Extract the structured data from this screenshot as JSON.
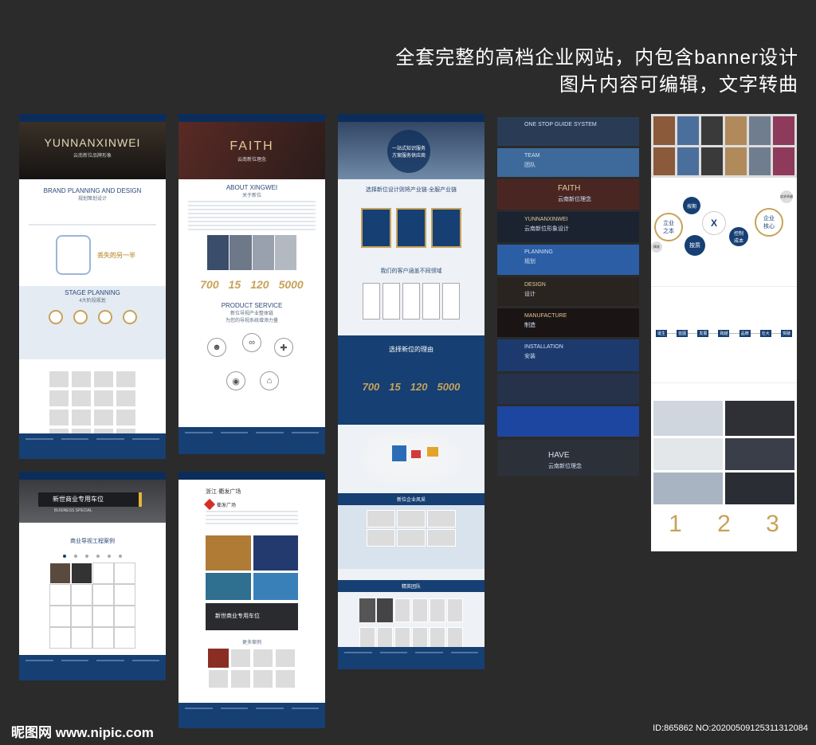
{
  "headline": {
    "line1": "全套完整的高档企业网站，内包含banner设计",
    "line2": "图片内容可编辑，文字转曲"
  },
  "panel1": {
    "hero_title": "YUNNANXINWEI",
    "hero_sub": "云南新位品牌形象",
    "sec1_en": "BRAND PLANNING AND DESIGN",
    "sec1_cn": "规划策划设计",
    "highlight": "丢失的另一半",
    "sec2_en": "STAGE PLANNING",
    "sec2_cn": "4大阶段规划"
  },
  "panel2": {
    "hero_title": "FAITH",
    "hero_sub": "云南新位理念",
    "about_en": "ABOUT XINGWEI",
    "about_cn": "关于新位",
    "numbers": [
      "700",
      "15",
      "120",
      "5000"
    ],
    "service_en": "PRODUCT SERVICE",
    "service_cn1": "新位导视产业整体链",
    "service_cn2": "为您的导视系统增添力量"
  },
  "panel3": {
    "hero_sub": "一站式知识服务 方案服务供应商",
    "intro": "选择新位设计则将产业链·全服产业链",
    "mid_title": "我们的客户涵盖不同领域",
    "reason_title": "选择新位的理由",
    "numbers": [
      "700",
      "15",
      "120",
      "5000"
    ],
    "style_title": "新位企业风采",
    "team_title": "精英团队"
  },
  "panel4": {
    "sign_text": "新世商业专用车位",
    "sign_en": "BUSINESS SPECIAL",
    "case_title": "商业导视工程案例"
  },
  "panel5": {
    "case_title": "浙江·衢发广场",
    "case_brand": "衢发广场",
    "sign_text": "新世商业专用车位",
    "more_title": "更多案例"
  },
  "banners": [
    {
      "title": "ONE STOP GUIDE SYSTEM",
      "sub": "",
      "bg": "#2a3c55"
    },
    {
      "title": "TEAM",
      "sub": "团队",
      "bg": "#3d6a9a"
    },
    {
      "title": "FAITH",
      "sub": "云南新位理念",
      "bg": "#4a2622"
    },
    {
      "title": "YUNNANXINWEI",
      "sub": "云南新位形象设计",
      "bg": "#1c2330"
    },
    {
      "title": "PLANNING",
      "sub": "规划",
      "bg": "#2c5ea6"
    },
    {
      "title": "DESIGN",
      "sub": "设计",
      "bg": "#2a2420"
    },
    {
      "title": "MANUFACTURE",
      "sub": "制造",
      "bg": "#1b1414"
    },
    {
      "title": "INSTALLATION",
      "sub": "安装",
      "bg": "#1d3a6e"
    },
    {
      "title": "",
      "sub": "",
      "bg": "#25324a"
    },
    {
      "title": "",
      "sub": "",
      "bg": "#1d46a0"
    },
    {
      "title": "HAVE",
      "sub": "云南新位理念",
      "bg": "#2c3038"
    }
  ],
  "panel6": {
    "core_left": "立业\n之本",
    "core_right": "企业\n核心",
    "center_a": "按期",
    "center_b": "按质",
    "center_c": "控制\n成本",
    "small_1": "追求卓越",
    "small_2": "精准",
    "timeline": [
      "诞生",
      "蓝图",
      "发展",
      "跨越",
      "品牌",
      "壮大",
      "突破"
    ],
    "big_numbers": [
      "1",
      "2",
      "3"
    ]
  },
  "watermark": {
    "brand": "昵图网 www.nipic.com",
    "id": "ID:865862 NO:20200509125311312084"
  },
  "colors": {
    "navy": "#0c2d5a",
    "brand_blue": "#163f73",
    "gold": "#c8a25a"
  }
}
